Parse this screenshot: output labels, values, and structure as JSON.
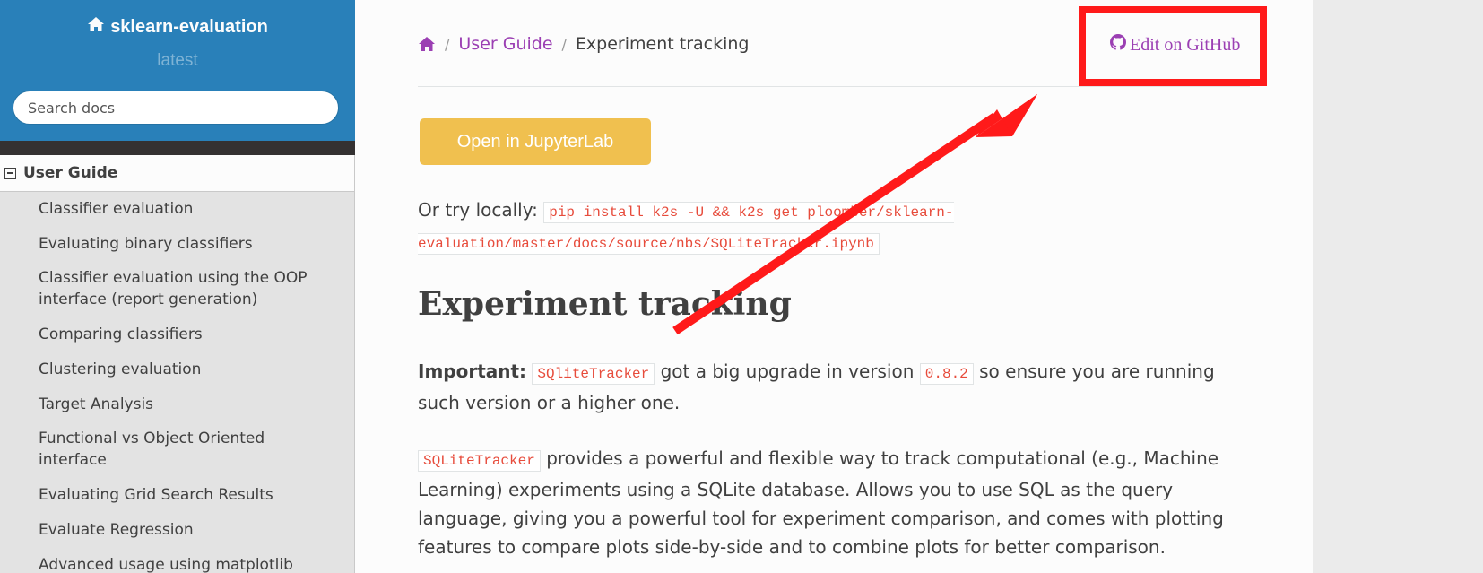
{
  "sidebar": {
    "project_name": "sklearn-evaluation",
    "version": "latest",
    "search_placeholder": "Search docs",
    "caption": "User Guide",
    "items": [
      {
        "label": "Classifier evaluation"
      },
      {
        "label": "Evaluating binary classifiers"
      },
      {
        "label": "Classifier evaluation using the OOP interface (report generation)"
      },
      {
        "label": "Comparing classifiers"
      },
      {
        "label": "Clustering evaluation"
      },
      {
        "label": "Target Analysis"
      },
      {
        "label": "Functional vs Object Oriented interface"
      },
      {
        "label": "Evaluating Grid Search Results"
      },
      {
        "label": "Evaluate Regression"
      },
      {
        "label": "Advanced usage using matplotlib"
      }
    ]
  },
  "breadcrumbs": {
    "section": "User Guide",
    "current": "Experiment tracking",
    "separator": "/"
  },
  "edit_link": "Edit on GitHub",
  "main": {
    "button_label": "Open in JupyterLab",
    "try_prefix": "Or try locally:",
    "try_command": "pip install k2s -U && k2s get ploomber/sklearn-evaluation/master/docs/source/nbs/SQLiteTracker.ipynb",
    "heading": "Experiment tracking",
    "para1": {
      "strong": "Important:",
      "code1": "SQliteTracker",
      "text1": "got a big upgrade in version",
      "code2": "0.8.2",
      "text2": "so ensure you are running such version or a higher one."
    },
    "para2": {
      "code": "SQLiteTracker",
      "text": "provides a powerful and flexible way to track computational (e.g., Machine Learning) experiments using a SQLite database. Allows you to use SQL as the query language, giving you a powerful tool for experiment comparison, and comes with plotting features to compare plots side-by-side and to combine plots for better comparison."
    }
  },
  "colors": {
    "sidebar_header": "#2980b9",
    "link": "#9b3fb3",
    "button": "#f0c04f",
    "code": "#e74c3c",
    "annotation": "#ff1a1a"
  }
}
